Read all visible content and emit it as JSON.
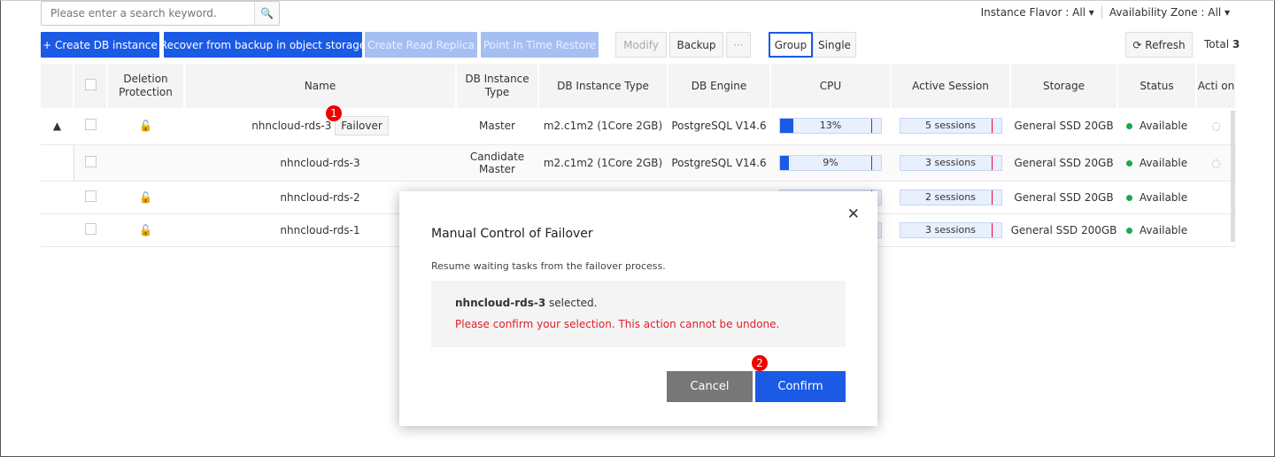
{
  "search": {
    "placeholder": "Please enter a search keyword.",
    "icon": "search-icon"
  },
  "filters": {
    "flavor": "Instance Flavor : All",
    "zone": "Availability Zone : All"
  },
  "toolbar": {
    "create": "Create DB instance",
    "recover": "Recover from backup in object storage",
    "replica": "Create Read Replica",
    "pitr": "Point In Time Restore",
    "modify": "Modify",
    "backup": "Backup",
    "more": "···",
    "group": "Group",
    "single": "Single",
    "refresh": "Refresh",
    "total_label": "Total",
    "total": "3"
  },
  "table": {
    "headers": [
      "Deletion Protection",
      "Name",
      "DB Instance Type",
      "DB Instance Type",
      "DB Engine",
      "CPU",
      "Active Session",
      "Storage",
      "Status",
      "Acti on"
    ],
    "rows": [
      {
        "name": "nhncloud-rds-3",
        "role": "Master",
        "type": "m2.c1m2 (1Core 2GB)",
        "engine": "PostgreSQL V14.6",
        "cpu": "13%",
        "cpu_value": 13,
        "session": "5 sessions",
        "storage": "General SSD 20GB",
        "status": "Available",
        "action_button": "Failover"
      },
      {
        "name": "nhncloud-rds-3",
        "role": "Candidate Master",
        "type": "m2.c1m2 (1Core 2GB)",
        "engine": "PostgreSQL V14.6",
        "cpu": "9%",
        "cpu_value": 9,
        "session": "3 sessions",
        "storage": "General SSD 20GB",
        "status": "Available"
      },
      {
        "name": "nhncloud-rds-2",
        "session": "2 sessions",
        "storage": "General SSD 20GB",
        "status": "Available"
      },
      {
        "name": "nhncloud-rds-1",
        "session": "3 sessions",
        "storage": "General SSD 200GB",
        "status": "Available"
      }
    ]
  },
  "steps": {
    "one": "1",
    "two": "2"
  },
  "modal": {
    "title": "Manual Control of Failover",
    "description": "Resume waiting tasks from the failover process.",
    "selected_name": "nhncloud-rds-3",
    "selected_suffix": " selected.",
    "warning": "Please confirm your selection. This action cannot be undone.",
    "cancel": "Cancel",
    "confirm": "Confirm"
  },
  "colors": {
    "primary": "#1b5ae5",
    "warning": "#e0202a",
    "available": "#1ea84a"
  }
}
